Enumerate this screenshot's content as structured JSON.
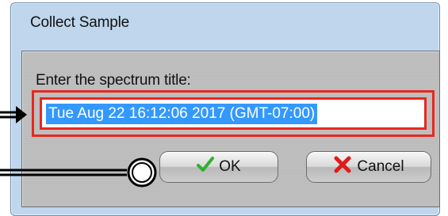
{
  "dialog": {
    "title": "Collect Sample",
    "prompt": "Enter the spectrum title:",
    "field_value": "Tue Aug 22 16:12:06 2017 (GMT-07:00)",
    "ok_label": "OK",
    "cancel_label": "Cancel",
    "ok_icon": "checkmark-icon",
    "cancel_icon": "x-icon"
  },
  "colors": {
    "highlight": "#e8271f",
    "selection": "#3399ff",
    "window_frame": "#bfd6ec",
    "ok_icon": "#2fb12f",
    "cancel_icon": "#e01b1b"
  },
  "annotations": {
    "arrow_to_field": "arrow-right-icon",
    "callout_to_ok": "callout-circle-icon"
  }
}
